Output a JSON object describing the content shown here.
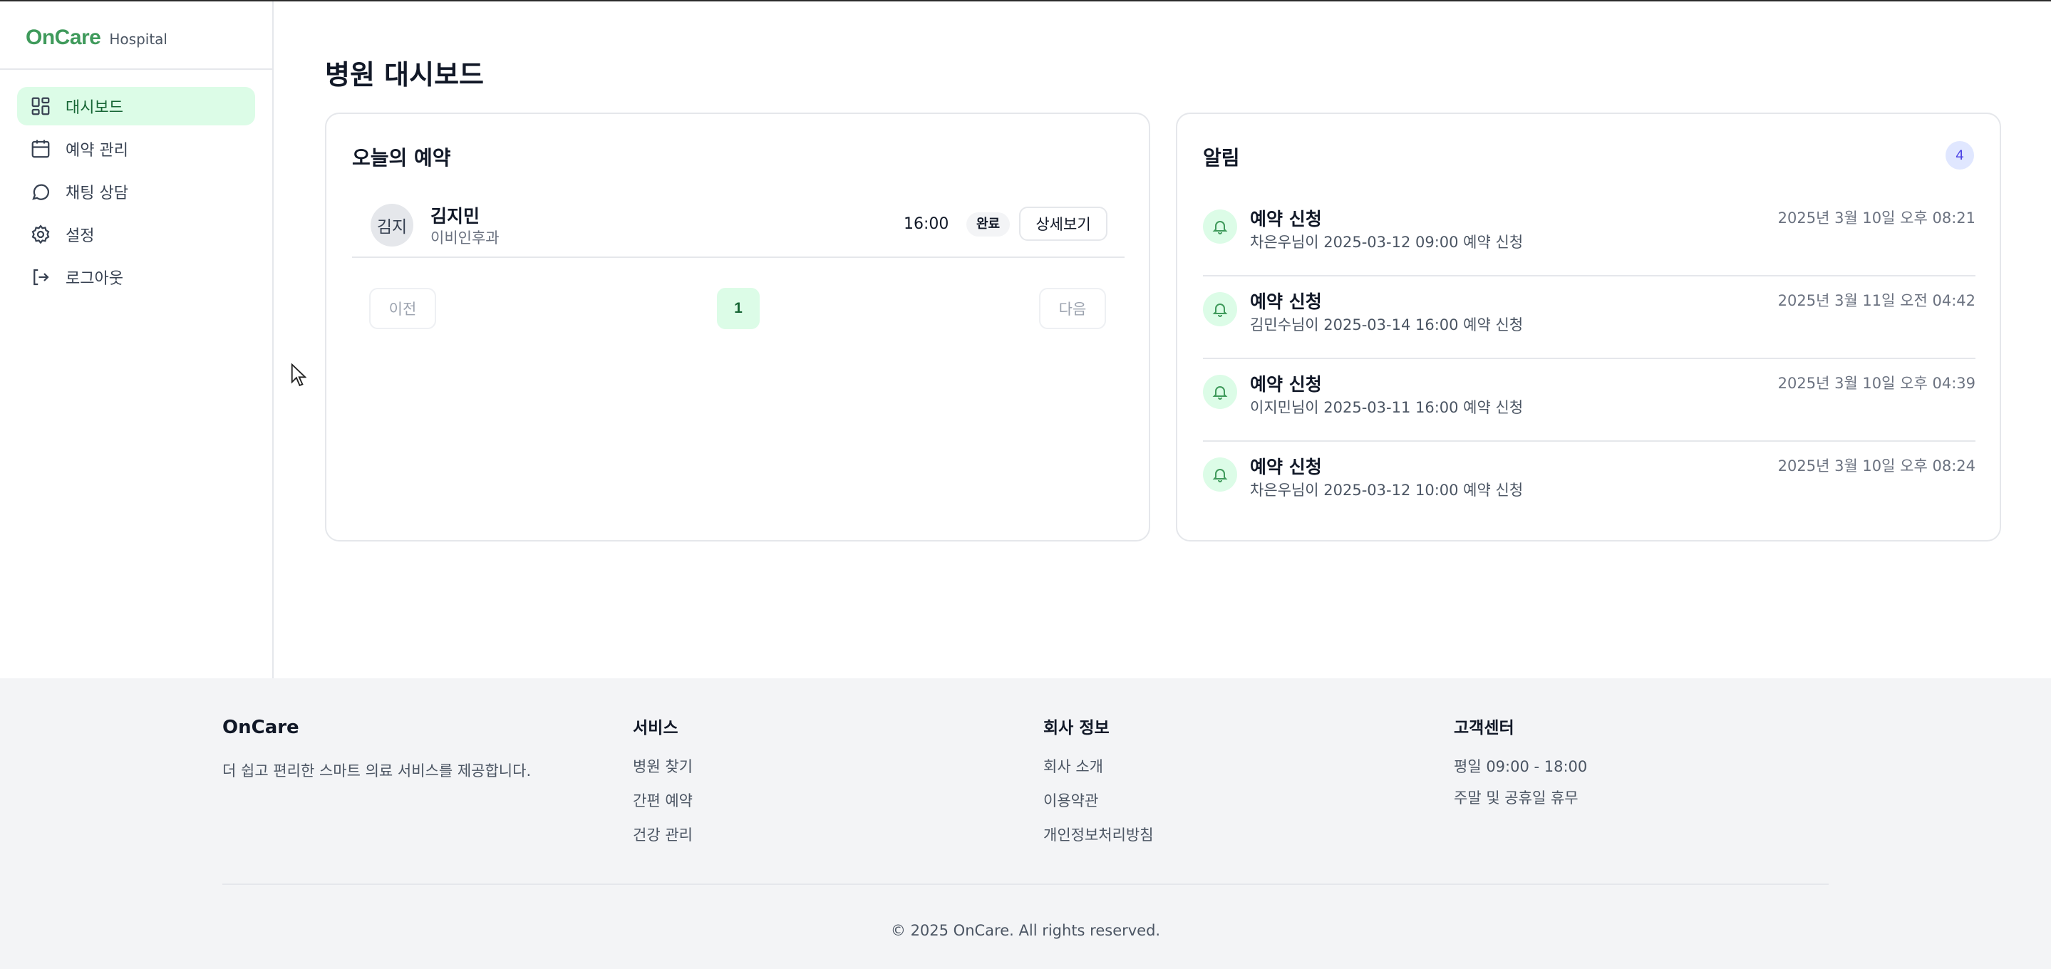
{
  "brand": {
    "name": "OnCare",
    "sub": "Hospital"
  },
  "sidebar": {
    "items": [
      {
        "label": "대시보드",
        "icon": "dashboard-icon",
        "active": true
      },
      {
        "label": "예약 관리",
        "icon": "calendar-icon"
      },
      {
        "label": "채팅 상담",
        "icon": "chat-icon"
      },
      {
        "label": "설정",
        "icon": "gear-icon"
      },
      {
        "label": "로그아웃",
        "icon": "logout-icon"
      }
    ]
  },
  "main": {
    "title": "병원 대시보드",
    "appointments": {
      "title": "오늘의 예약",
      "items": [
        {
          "avatar": "김지",
          "name": "김지민",
          "dept": "이비인후과",
          "time": "16:00",
          "status": "완료",
          "detail_label": "상세보기"
        }
      ],
      "pager": {
        "prev": "이전",
        "page": "1",
        "next": "다음"
      }
    },
    "notifications": {
      "title": "알림",
      "count": "4",
      "items": [
        {
          "title": "예약 신청",
          "body": "차은우님이 2025-03-12 09:00 예약 신청",
          "time": "2025년 3월 10일 오후 08:21"
        },
        {
          "title": "예약 신청",
          "body": "김민수님이 2025-03-14 16:00 예약 신청",
          "time": "2025년 3월 11일 오전 04:42"
        },
        {
          "title": "예약 신청",
          "body": "이지민님이 2025-03-11 16:00 예약 신청",
          "time": "2025년 3월 10일 오후 04:39"
        },
        {
          "title": "예약 신청",
          "body": "차은우님이 2025-03-12 10:00 예약 신청",
          "time": "2025년 3월 10일 오후 08:24"
        }
      ]
    }
  },
  "footer": {
    "brand": "OnCare",
    "desc": "더 쉽고 편리한 스마트 의료 서비스를 제공합니다.",
    "services": {
      "title": "서비스",
      "links": [
        "병원 찾기",
        "간편 예약",
        "건강 관리"
      ]
    },
    "company": {
      "title": "회사 정보",
      "links": [
        "회사 소개",
        "이용약관",
        "개인정보처리방침"
      ]
    },
    "support": {
      "title": "고객센터",
      "lines": [
        "평일 09:00 - 18:00",
        "주말 및 공휴일 휴무"
      ]
    },
    "copyright": "© 2025 OnCare. All rights reserved."
  },
  "colors": {
    "accent": "#3f9a5b",
    "active_bg": "#dcfce7",
    "footer_bg": "#f3f4f6"
  }
}
